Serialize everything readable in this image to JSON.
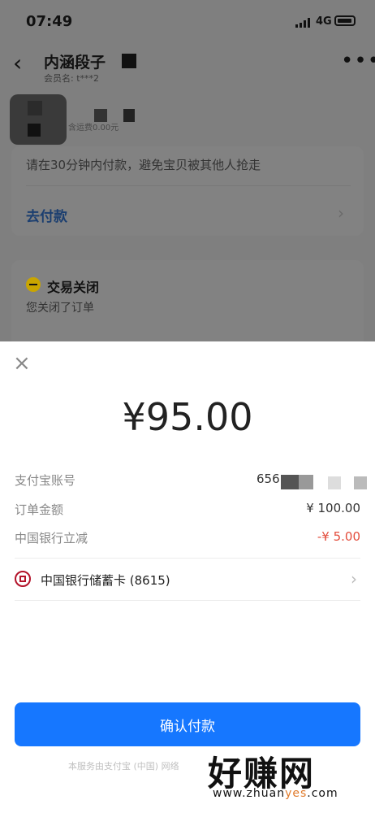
{
  "status_bar": {
    "time": "07:49",
    "network": "4G"
  },
  "header": {
    "back_glyph": "‹",
    "title": "内涵段子",
    "member_label": "会员名: t***2",
    "more_glyph": "•••"
  },
  "order": {
    "fee_text": "含运费0.00元"
  },
  "pending_card": {
    "notice": "请在30分钟内付款，避免宝贝被其他人抢走",
    "pay_link": "去付款",
    "arrow": "›"
  },
  "closed_card": {
    "title": "交易关闭",
    "desc": "您关闭了订单"
  },
  "payment_sheet": {
    "close_glyph": "×",
    "amount": "¥95.00",
    "account": {
      "label": "支付宝账号",
      "value": "656"
    },
    "order_amount": {
      "label": "订单金额",
      "value": "¥ 100.00"
    },
    "discount": {
      "label": "中国银行立减",
      "value": "-¥ 5.00"
    },
    "payment_method": {
      "label": "中国银行储蓄卡 (8615)",
      "arrow": "›"
    },
    "confirm_button": "确认付款",
    "footer": "本服务由支付宝 (中国) 网络"
  },
  "watermark": {
    "text": "好赚网",
    "url_prefix": "www.zhuan",
    "url_highlight": "yes",
    "url_suffix": ".com"
  },
  "colors": {
    "primary": "#1677ff",
    "discount": "#e34d3c",
    "bank_red": "#b3132a"
  }
}
